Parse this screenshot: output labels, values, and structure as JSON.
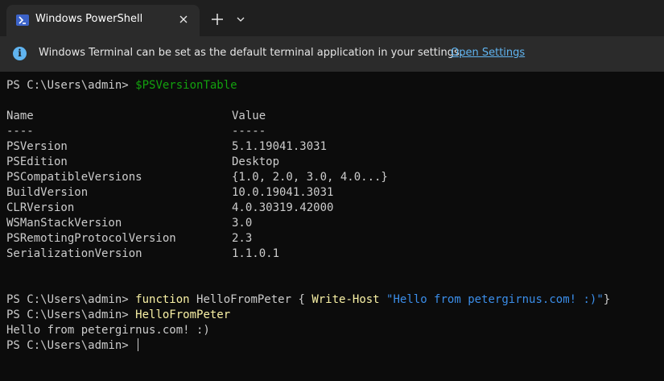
{
  "tab": {
    "title": "Windows PowerShell",
    "icon": "powershell-icon"
  },
  "infobar": {
    "message": "Windows Terminal can be set as the default terminal application in your settings.",
    "link": "Open Settings",
    "icon": "info-icon"
  },
  "colors": {
    "background": "#0c0c0c",
    "tab_bar": "#1f1f1f",
    "info_bar": "#2b2b2b",
    "variable": "#13a10e",
    "command": "#f9f1a5",
    "string": "#3b8eea",
    "link": "#60b4f0"
  },
  "terminal": {
    "prompt": "PS C:\\Users\\admin> ",
    "cmd1": "$PSVersionTable",
    "header_name": "Name",
    "header_value": "Value",
    "sep_name": "----",
    "sep_value": "-----",
    "rows": [
      {
        "name": "PSVersion",
        "value": "5.1.19041.3031"
      },
      {
        "name": "PSEdition",
        "value": "Desktop"
      },
      {
        "name": "PSCompatibleVersions",
        "value": "{1.0, 2.0, 3.0, 4.0...}"
      },
      {
        "name": "BuildVersion",
        "value": "10.0.19041.3031"
      },
      {
        "name": "CLRVersion",
        "value": "4.0.30319.42000"
      },
      {
        "name": "WSManStackVersion",
        "value": "3.0"
      },
      {
        "name": "PSRemotingProtocolVersion",
        "value": "2.3"
      },
      {
        "name": "SerializationVersion",
        "value": "1.1.0.1"
      }
    ],
    "cmd2_keyword": "function",
    "cmd2_name": " HelloFromPeter { ",
    "cmd2_cmdlet": "Write-Host",
    "cmd2_space": " ",
    "cmd2_string": "\"Hello from petergirnus.com! :)\"",
    "cmd2_end": "}",
    "cmd3": "HelloFromPeter",
    "output": "Hello from petergirnus.com! :)"
  }
}
